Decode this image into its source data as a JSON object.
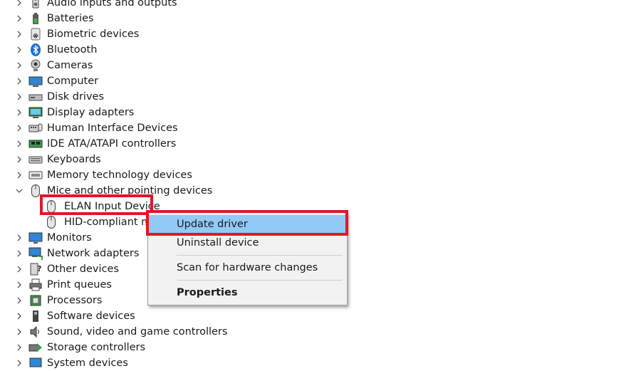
{
  "tree": {
    "categories": [
      {
        "label": "Audio inputs and outputs",
        "icon": "speaker-icon",
        "expanded": false
      },
      {
        "label": "Batteries",
        "icon": "battery-icon",
        "expanded": false
      },
      {
        "label": "Biometric devices",
        "icon": "fingerprint-icon",
        "expanded": false
      },
      {
        "label": "Bluetooth",
        "icon": "bluetooth-icon",
        "expanded": false
      },
      {
        "label": "Cameras",
        "icon": "camera-icon",
        "expanded": false
      },
      {
        "label": "Computer",
        "icon": "computer-icon",
        "expanded": false
      },
      {
        "label": "Disk drives",
        "icon": "disk-drive-icon",
        "expanded": false
      },
      {
        "label": "Display adapters",
        "icon": "display-adapter-icon",
        "expanded": false
      },
      {
        "label": "Human Interface Devices",
        "icon": "hid-icon",
        "expanded": false
      },
      {
        "label": "IDE ATA/ATAPI controllers",
        "icon": "ide-controller-icon",
        "expanded": false
      },
      {
        "label": "Keyboards",
        "icon": "keyboard-icon",
        "expanded": false
      },
      {
        "label": "Memory technology devices",
        "icon": "memory-device-icon",
        "expanded": false
      },
      {
        "label": "Mice and other pointing devices",
        "icon": "mouse-icon",
        "expanded": true
      },
      {
        "label": "Monitors",
        "icon": "monitor-icon",
        "expanded": false
      },
      {
        "label": "Network adapters",
        "icon": "network-adapter-icon",
        "expanded": false
      },
      {
        "label": "Other devices",
        "icon": "other-devices-icon",
        "expanded": false
      },
      {
        "label": "Print queues",
        "icon": "printer-icon",
        "expanded": false
      },
      {
        "label": "Processors",
        "icon": "processor-icon",
        "expanded": false
      },
      {
        "label": "Software devices",
        "icon": "software-device-icon",
        "expanded": false
      },
      {
        "label": "Sound, video and game controllers",
        "icon": "sound-icon",
        "expanded": false
      },
      {
        "label": "Storage controllers",
        "icon": "storage-controller-icon",
        "expanded": false
      },
      {
        "label": "System devices",
        "icon": "system-device-icon",
        "expanded": false
      }
    ],
    "mice_children": [
      {
        "label": "ELAN Input Device",
        "icon": "mouse-icon"
      },
      {
        "label": "HID-compliant mo",
        "icon": "mouse-icon"
      }
    ]
  },
  "context_menu": {
    "items": [
      {
        "label": "Update driver",
        "selected": true,
        "bold": false
      },
      {
        "label": "Uninstall device",
        "selected": false,
        "bold": false
      },
      {
        "label": "Scan for hardware changes",
        "selected": false,
        "bold": false
      },
      {
        "label": "Properties",
        "selected": false,
        "bold": true
      }
    ]
  },
  "colors": {
    "highlight_border": "#e0162b",
    "menu_selection": "#91c9f7",
    "menu_background": "#f2f2f2"
  }
}
